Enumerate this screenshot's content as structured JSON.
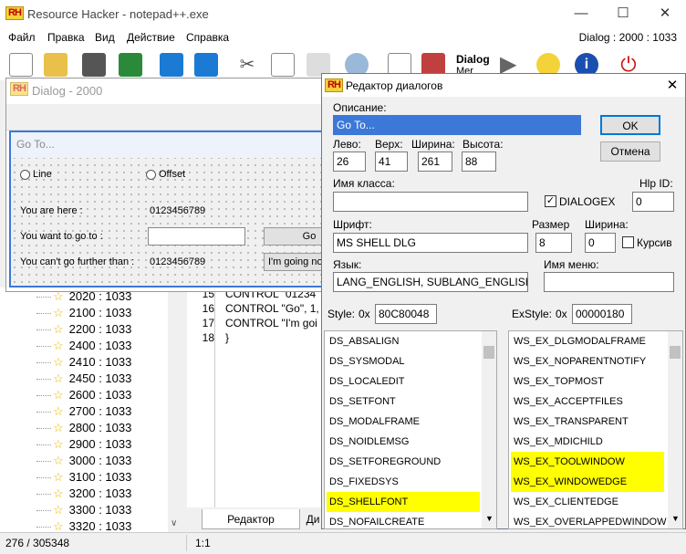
{
  "app": {
    "title": "Resource Hacker - notepad++.exe",
    "logo": "RH",
    "dialog_id": "Dialog : 2000 : 1033"
  },
  "menu": [
    "Файл",
    "Правка",
    "Вид",
    "Действие",
    "Справка"
  ],
  "toolbar": {
    "dialog_merger_label": "Dialog",
    "dialog_merger_sub": "Mer"
  },
  "tree": {
    "items": [
      "2020 : 1033",
      "2100 : 1033",
      "2200 : 1033",
      "2400 : 1033",
      "2410 : 1033",
      "2450 : 1033",
      "2600 : 1033",
      "2700 : 1033",
      "2800 : 1033",
      "2900 : 1033",
      "3000 : 1033",
      "3100 : 1033",
      "3200 : 1033",
      "3300 : 1033",
      "3320 : 1033"
    ]
  },
  "code": {
    "lines": [
      {
        "n": "15",
        "t": "CONTROL \"01234"
      },
      {
        "n": "16",
        "t": "CONTROL \"Go\", 1,"
      },
      {
        "n": "17",
        "t": "CONTROL \"I'm goi"
      },
      {
        "n": "18",
        "t": "}"
      }
    ]
  },
  "tabs": {
    "editor": "Редактор",
    "other": "Ди"
  },
  "status": {
    "position": "276 / 305348",
    "cursor": "1:1"
  },
  "preview": {
    "window_title": "Dialog - 2000",
    "caption": "Go To...",
    "radio_line": "Line",
    "radio_offset": "Offset",
    "here_label": "You are here :",
    "here_value": "0123456789",
    "goto_label": "You want to go to :",
    "go_button": "Go",
    "limit_label": "You can't go further than :",
    "limit_value": "0123456789",
    "going_button": "I'm going now"
  },
  "editor": {
    "title": "Редактор диалогов",
    "caption_label": "Описание:",
    "caption_value": "Go To...",
    "ok": "OK",
    "cancel": "Отмена",
    "left_label": "Лево:",
    "left": "26",
    "top_label": "Верх:",
    "top": "41",
    "width_label": "Ширина:",
    "width": "261",
    "height_label": "Высота:",
    "height": "88",
    "class_label": "Имя класса:",
    "class_value": "",
    "dialogex_label": "DIALOGEX",
    "dialogex_checked": "✓",
    "help_label": "Hlp ID:",
    "help_value": "0",
    "font_label": "Шрифт:",
    "font_value": "MS SHELL DLG",
    "size_label": "Размер",
    "size_value": "8",
    "fwidth_label": "Ширина:",
    "fwidth_value": "0",
    "italic_label": "Курсив",
    "lang_label": "Язык:",
    "lang_value": "LANG_ENGLISH, SUBLANG_ENGLISH_US",
    "menu_label": "Имя меню:",
    "menu_value": "",
    "style_label": "Style:",
    "style_prefix": "0x",
    "style_value": "80C80048",
    "exstyle_label": "ExStyle:",
    "exstyle_prefix": "0x",
    "exstyle_value": "00000180",
    "styles": [
      {
        "name": "DS_ABSALIGN",
        "on": false
      },
      {
        "name": "DS_SYSMODAL",
        "on": false
      },
      {
        "name": "DS_LOCALEDIT",
        "on": false
      },
      {
        "name": "DS_SETFONT",
        "on": false
      },
      {
        "name": "DS_MODALFRAME",
        "on": false
      },
      {
        "name": "DS_NOIDLEMSG",
        "on": false
      },
      {
        "name": "DS_SETFOREGROUND",
        "on": false
      },
      {
        "name": "DS_FIXEDSYS",
        "on": false
      },
      {
        "name": "DS_SHELLFONT",
        "on": true
      },
      {
        "name": "DS_NOFAILCREATE",
        "on": false
      }
    ],
    "exstyles": [
      {
        "name": "WS_EX_DLGMODALFRAME",
        "on": false
      },
      {
        "name": "WS_EX_NOPARENTNOTIFY",
        "on": false
      },
      {
        "name": "WS_EX_TOPMOST",
        "on": false
      },
      {
        "name": "WS_EX_ACCEPTFILES",
        "on": false
      },
      {
        "name": "WS_EX_TRANSPARENT",
        "on": false
      },
      {
        "name": "WS_EX_MDICHILD",
        "on": false
      },
      {
        "name": "WS_EX_TOOLWINDOW",
        "on": true
      },
      {
        "name": "WS_EX_WINDOWEDGE",
        "on": true
      },
      {
        "name": "WS_EX_CLIENTEDGE",
        "on": false
      },
      {
        "name": "WS_EX_OVERLAPPEDWINDOW",
        "on": false
      }
    ]
  },
  "colors": {
    "highlight": "#ffff00",
    "accent": "#3c78d8"
  }
}
